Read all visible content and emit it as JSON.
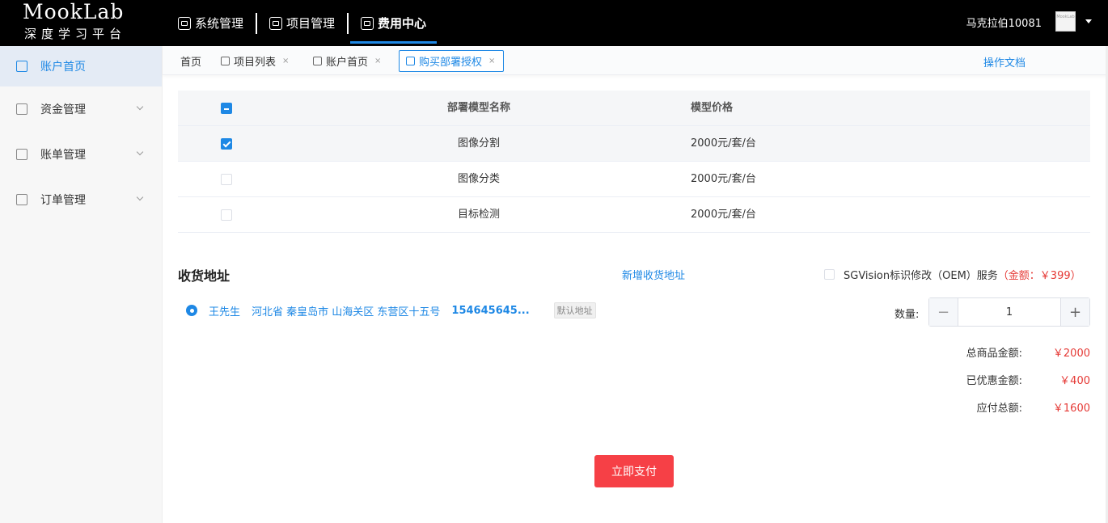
{
  "logo": {
    "main": "MookLab",
    "sub": "深度学习平台"
  },
  "topnav": [
    {
      "label": "系统管理",
      "icon": "monitor-icon"
    },
    {
      "label": "项目管理",
      "icon": "robot-icon"
    },
    {
      "label": "费用中心",
      "icon": "yen-icon",
      "active": true
    }
  ],
  "user": {
    "name": "马克拉伯10081",
    "avatar_text": "MookLab"
  },
  "sidebar": {
    "items": [
      {
        "label": "账户首页",
        "active": true
      },
      {
        "label": "资金管理",
        "expandable": true
      },
      {
        "label": "账单管理",
        "expandable": true
      },
      {
        "label": "订单管理",
        "expandable": true
      }
    ]
  },
  "tabs": [
    {
      "label": "首页"
    },
    {
      "label": "项目列表",
      "close": "×"
    },
    {
      "label": "账户首页",
      "close": "×"
    },
    {
      "label": "购买部署授权",
      "close": "×",
      "active": true
    }
  ],
  "doc_link": "操作文档",
  "table": {
    "headers": {
      "name": "部署模型名称",
      "price": "模型价格"
    },
    "rows": [
      {
        "name": "图像分割",
        "price": "2000元/套/台",
        "checked": true
      },
      {
        "name": "图像分类",
        "price": "2000元/套/台",
        "checked": false
      },
      {
        "name": "目标检测",
        "price": "2000元/套/台",
        "checked": false
      }
    ]
  },
  "address": {
    "title": "收货地址",
    "add_label": "新增收货地址",
    "entry": {
      "name": "王先生",
      "location": "河北省 秦皇岛市 山海关区 东营区十五号",
      "phone": "154645645...",
      "badge": "默认地址"
    }
  },
  "oem": {
    "label": "SGVision标识修改（OEM）服务",
    "price": "（金额：￥399）"
  },
  "quantity": {
    "label": "数量:",
    "value": "1",
    "minus": "−",
    "plus": "+"
  },
  "totals": [
    {
      "label": "总商品金额:",
      "amount": "￥2000"
    },
    {
      "label": "已优惠金额:",
      "amount": "￥400"
    },
    {
      "label": "应付总额:",
      "amount": "￥1600"
    }
  ],
  "pay_button": "立即支付",
  "colors": {
    "accent": "#1e88e5",
    "danger": "#e53935",
    "pay": "#f64046",
    "topbar": "#000000"
  }
}
